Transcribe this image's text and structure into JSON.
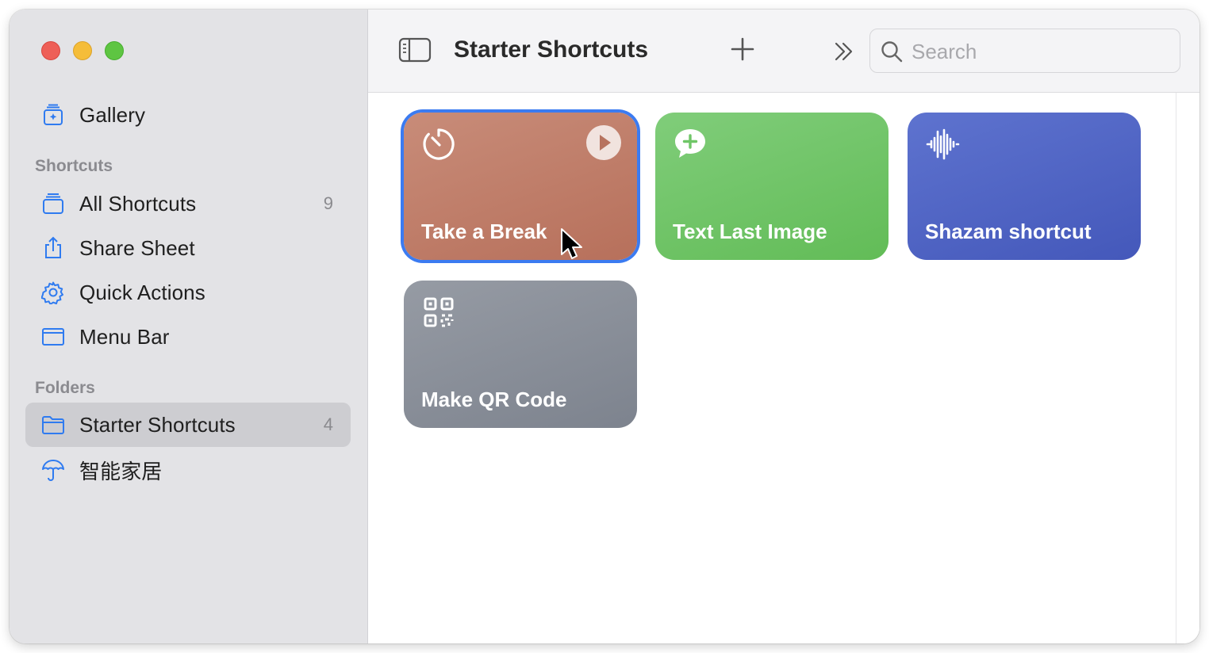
{
  "window": {
    "title": "Starter Shortcuts",
    "traffic_lights": [
      "close",
      "minimize",
      "zoom"
    ]
  },
  "sidebar": {
    "gallery": {
      "label": "Gallery",
      "icon": "gallery-icon"
    },
    "sections": {
      "shortcuts": "Shortcuts",
      "folders": "Folders"
    },
    "shortcut_items": [
      {
        "label": "All Shortcuts",
        "count": "9",
        "icon": "stack-icon"
      },
      {
        "label": "Share Sheet",
        "icon": "share-icon"
      },
      {
        "label": "Quick Actions",
        "icon": "gear-icon"
      },
      {
        "label": "Menu Bar",
        "icon": "menubar-icon"
      }
    ],
    "folder_items": [
      {
        "label": "Starter Shortcuts",
        "count": "4",
        "icon": "folder-icon",
        "selected": true
      },
      {
        "label": "智能家居",
        "icon": "umbrella-icon"
      }
    ]
  },
  "toolbar": {
    "title": "Starter Shortcuts",
    "search_placeholder": "Search"
  },
  "cards": [
    {
      "title": "Take a Break",
      "icon": "timer-icon",
      "color": "#c07c68",
      "selected": true
    },
    {
      "title": "Text Last Image",
      "icon": "message-plus-icon",
      "color": "#6fc667"
    },
    {
      "title": "Shazam shortcut",
      "icon": "waveform-icon",
      "color": "#4f63c4"
    },
    {
      "title": "Make QR Code",
      "icon": "qrcode-icon",
      "color": "#898e98"
    }
  ],
  "colors": {
    "accent": "#3b7bf1",
    "sidebar_icon": "#2f7bf0"
  }
}
